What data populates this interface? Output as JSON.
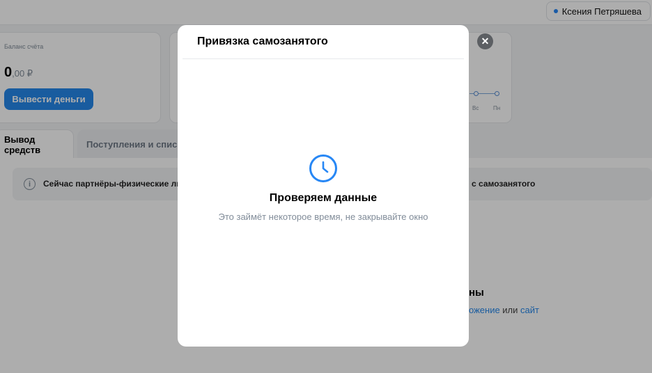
{
  "header": {
    "user_name": "Ксения Петряшева"
  },
  "balance": {
    "label": "Баланс счёта",
    "amount_int": "0",
    "amount_dec": ",00 ₽",
    "withdraw_label": "Вывести деньги"
  },
  "chart": {
    "days": [
      "Вс",
      "Пн"
    ]
  },
  "tabs": [
    {
      "label": "Вывод средств"
    },
    {
      "label": "Поступления и списан"
    }
  ],
  "notice": {
    "text_left": "Сейчас партнёры-физические лиц",
    "text_right": "с самозанятого"
  },
  "empty_state": {
    "title_fragment": "ны",
    "link1": "ожение",
    "or": " или ",
    "link2": "сайт"
  },
  "modal": {
    "title": "Привязка самозанятого",
    "status_title": "Проверяем данные",
    "status_sub": "Это займёт некоторое время, не закрывайте окно",
    "close_symbol": "✕"
  },
  "colors": {
    "accent": "#2688eb",
    "clock": "#2787f5"
  },
  "icons": {
    "info": "info-icon",
    "clock": "clock-icon",
    "close": "close-icon"
  }
}
